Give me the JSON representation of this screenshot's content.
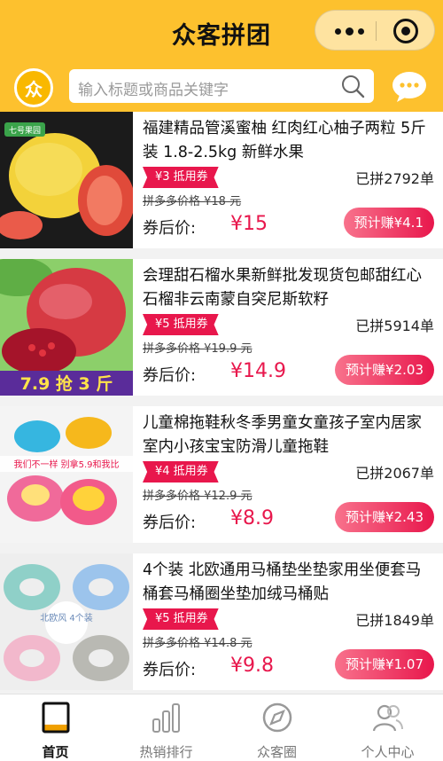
{
  "header": {
    "title": "众客拼团"
  },
  "search": {
    "logo_text": "众",
    "placeholder": "输入标题或商品关键字"
  },
  "products": [
    {
      "title": "福建精品管溪蜜柚 红肉红心柚子两粒 5斤装 1.8-2.5kg 新鲜水果",
      "coupon": "¥3 抵用券",
      "sold": "已拼2792单",
      "original_price": "拼多多价格 ¥18 元",
      "after_label": "券后价:",
      "price": "¥15",
      "earn": "预计赚¥4.1",
      "badge": "七号果园"
    },
    {
      "title": "会理甜石榴水果新鲜批发现货包邮甜红心石榴非云南蒙自突尼斯软籽",
      "coupon": "¥5 抵用券",
      "sold": "已拼5914单",
      "original_price": "拼多多价格 ¥19.9 元",
      "after_label": "券后价:",
      "price": "¥14.9",
      "earn": "预计赚¥2.03",
      "badge": "7.9 抢 3 斤"
    },
    {
      "title": "儿童棉拖鞋秋冬季男童女童孩子室内居家室内小孩宝宝防滑儿童拖鞋",
      "coupon": "¥4 抵用券",
      "sold": "已拼2067单",
      "original_price": "拼多多价格 ¥12.9 元",
      "after_label": "券后价:",
      "price": "¥8.9",
      "earn": "预计赚¥2.43",
      "badge": "我们不一样 别拿5.9和我比"
    },
    {
      "title": "4个装 北欧通用马桶垫坐垫家用坐便套马桶套马桶圈坐垫加绒马桶贴",
      "coupon": "¥5 抵用券",
      "sold": "已拼1849单",
      "original_price": "拼多多价格 ¥14.8 元",
      "after_label": "券后价:",
      "price": "¥9.8",
      "earn": "预计赚¥1.07",
      "badge": "北欧风 4个装"
    }
  ],
  "tabs": [
    {
      "label": "首页",
      "icon": "home-book-icon",
      "active": true
    },
    {
      "label": "热销排行",
      "icon": "bar-chart-icon",
      "active": false
    },
    {
      "label": "众客圈",
      "icon": "compass-icon",
      "active": false
    },
    {
      "label": "个人中心",
      "icon": "people-icon",
      "active": false
    }
  ],
  "colors": {
    "brand_yellow": "#fdc12e",
    "accent_red": "#e8174c",
    "earn_pink": "#f8728c"
  }
}
